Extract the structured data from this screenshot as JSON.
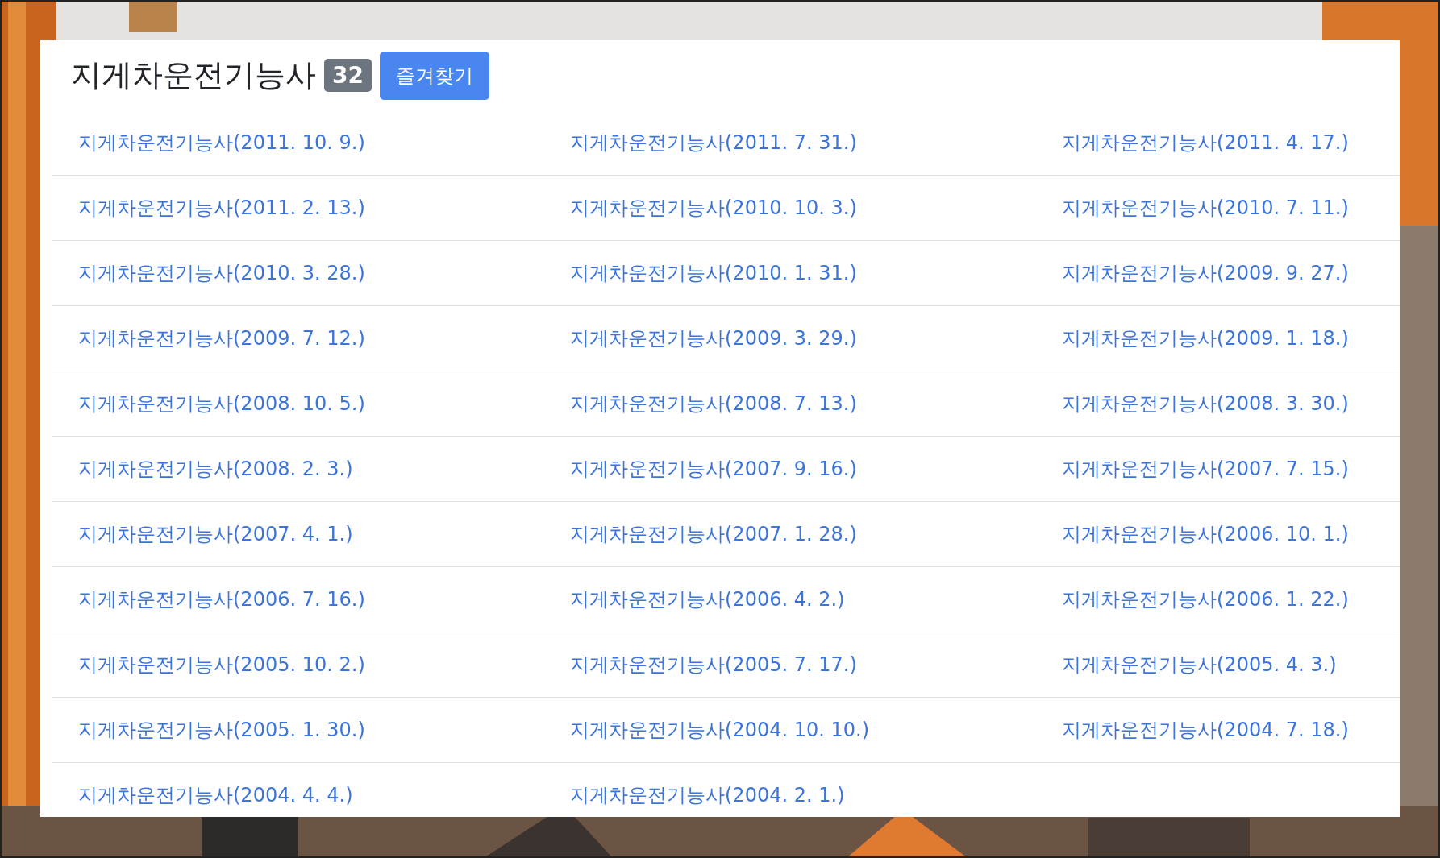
{
  "title": "지게차운전기능사",
  "count": "32",
  "favorite_button": "즐겨찾기",
  "exams": [
    "지게차운전기능사(2011. 10. 9.)",
    "지게차운전기능사(2011. 7. 31.)",
    "지게차운전기능사(2011. 4. 17.)",
    "지게차운전기능사(2011. 2. 13.)",
    "지게차운전기능사(2010. 10. 3.)",
    "지게차운전기능사(2010. 7. 11.)",
    "지게차운전기능사(2010. 3. 28.)",
    "지게차운전기능사(2010. 1. 31.)",
    "지게차운전기능사(2009. 9. 27.)",
    "지게차운전기능사(2009. 7. 12.)",
    "지게차운전기능사(2009. 3. 29.)",
    "지게차운전기능사(2009. 1. 18.)",
    "지게차운전기능사(2008. 10. 5.)",
    "지게차운전기능사(2008. 7. 13.)",
    "지게차운전기능사(2008. 3. 30.)",
    "지게차운전기능사(2008. 2. 3.)",
    "지게차운전기능사(2007. 9. 16.)",
    "지게차운전기능사(2007. 7. 15.)",
    "지게차운전기능사(2007. 4. 1.)",
    "지게차운전기능사(2007. 1. 28.)",
    "지게차운전기능사(2006. 10. 1.)",
    "지게차운전기능사(2006. 7. 16.)",
    "지게차운전기능사(2006. 4. 2.)",
    "지게차운전기능사(2006. 1. 22.)",
    "지게차운전기능사(2005. 10. 2.)",
    "지게차운전기능사(2005. 7. 17.)",
    "지게차운전기능사(2005. 4. 3.)",
    "지게차운전기능사(2005. 1. 30.)",
    "지게차운전기능사(2004. 10. 10.)",
    "지게차운전기능사(2004. 7. 18.)",
    "지게차운전기능사(2004. 4. 4.)",
    "지게차운전기능사(2004. 2. 1.)"
  ]
}
